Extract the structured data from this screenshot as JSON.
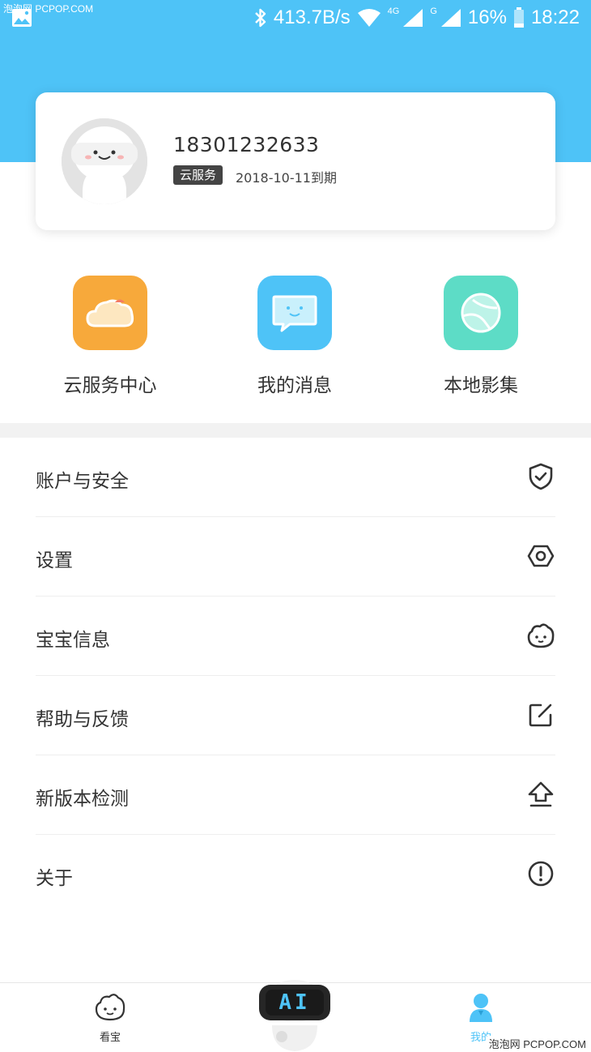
{
  "statusbar": {
    "watermark": "泡泡网 PCPOP.COM",
    "speed": "413.7B/s",
    "net_4g": "4G",
    "net_g": "G",
    "battery": "16%",
    "time": "18:22"
  },
  "profile": {
    "phone": "18301232633",
    "badge": "云服务",
    "expire": "2018-10-11到期"
  },
  "quick_actions": [
    {
      "label": "云服务中心",
      "icon": "cloud-icon",
      "color": "#f7a93b"
    },
    {
      "label": "我的消息",
      "icon": "message-icon",
      "color": "#4ec3f7"
    },
    {
      "label": "本地影集",
      "icon": "album-icon",
      "color": "#5ddcc6"
    }
  ],
  "menu": [
    {
      "label": "账户与安全",
      "icon": "shield-icon"
    },
    {
      "label": "设置",
      "icon": "hex-settings-icon"
    },
    {
      "label": "宝宝信息",
      "icon": "baby-face-icon"
    },
    {
      "label": "帮助与反馈",
      "icon": "edit-icon"
    },
    {
      "label": "新版本检测",
      "icon": "upload-icon"
    },
    {
      "label": "关于",
      "icon": "exclamation-icon"
    }
  ],
  "bottom_nav": {
    "items": [
      {
        "label": "看宝",
        "icon": "baby-face-icon"
      },
      {
        "label": "我的",
        "icon": "user-icon",
        "active": true
      }
    ],
    "center_robot_text": "AI"
  },
  "watermark_bottom": "泡泡网 PCPOP.COM",
  "colors": {
    "accent": "#4ec3f7",
    "text": "#333333"
  }
}
